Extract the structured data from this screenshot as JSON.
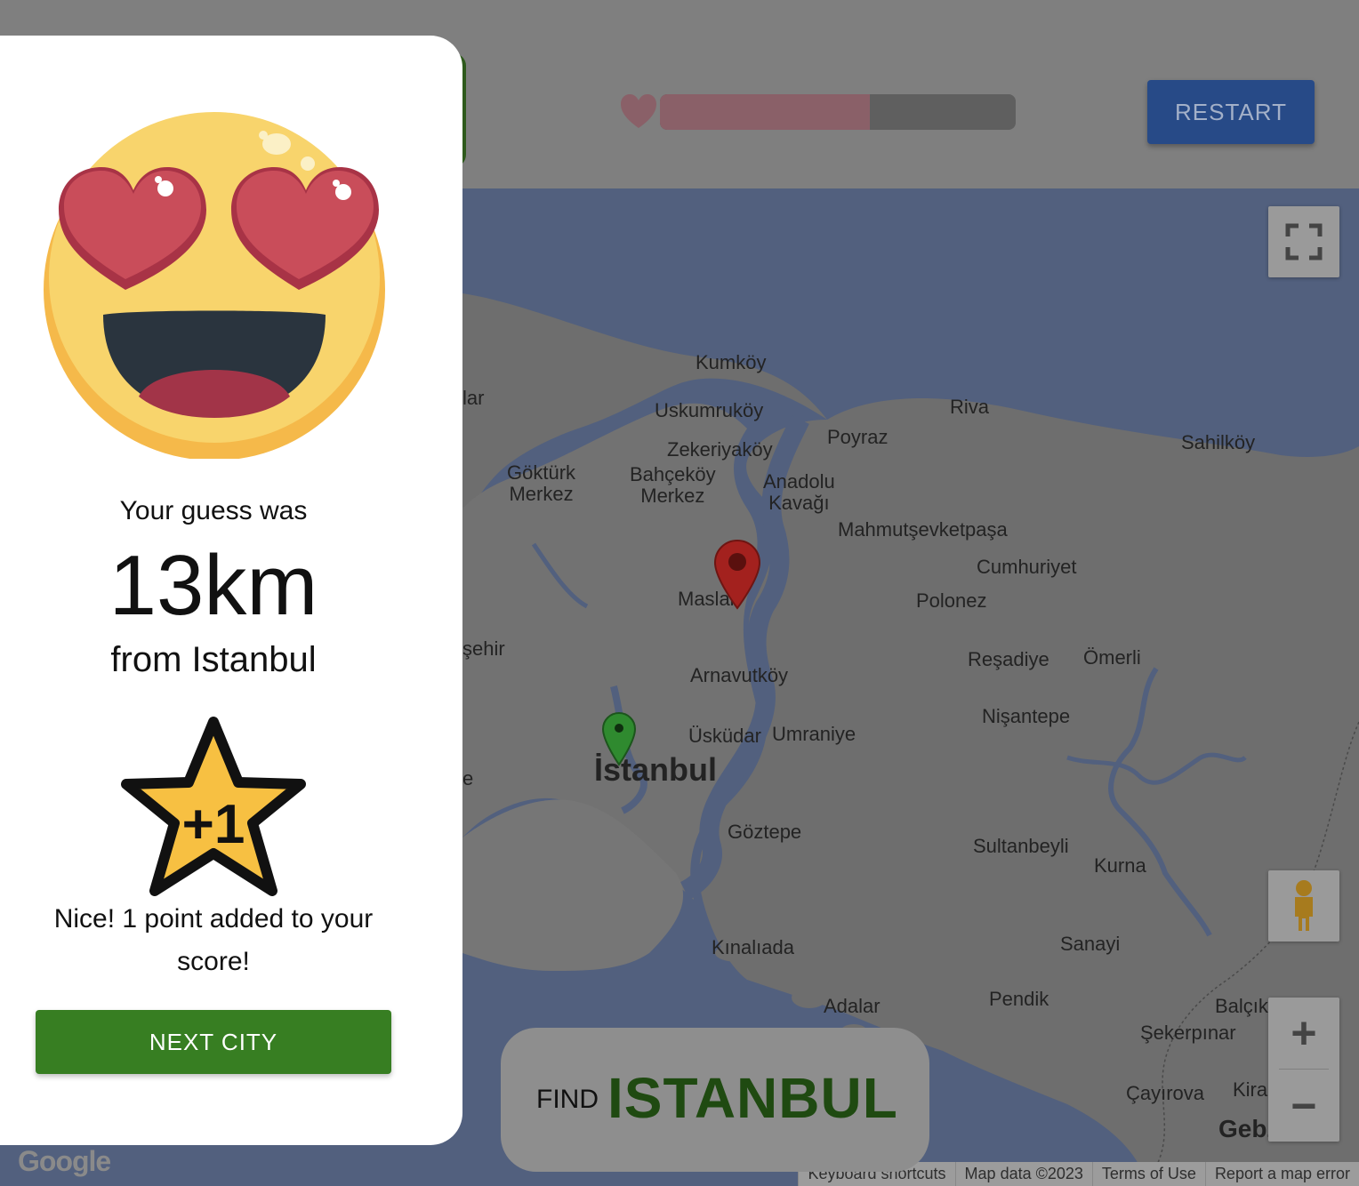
{
  "header": {
    "restart_label": "RESTART",
    "lives_fraction": 0.59
  },
  "result": {
    "guess_label": "Your guess was",
    "distance": "13km",
    "from_city": "from Istanbul",
    "star_badge": "+1",
    "points_message": "Nice! 1 point added to your score!",
    "next_label": "NEXT CITY"
  },
  "find": {
    "prefix": "FIND",
    "city": "ISTANBUL"
  },
  "map": {
    "places": {
      "kumkoy": "Kumköy",
      "uskumrukoy": "Uskumruköy",
      "zekeriyakoy": "Zekeriyaköy",
      "poyraz": "Poyraz",
      "riva": "Riva",
      "sahilkoy": "Sahilköy",
      "gokturk": "Göktürk\nMerkez",
      "bahcekoy": "Bahçeköy\nMerkez",
      "anadolu": "Anadolu\nKavağı",
      "mahmut": "Mahmutşevketpaşa",
      "cumhuriyet": "Cumhuriyet",
      "maslak": "Maslak",
      "polonez": "Polonez",
      "arnavutkoy": "Arnavutköy",
      "resadiye": "Reşadiye",
      "omerli": "Ömerli",
      "nisantepe": "Nişantepe",
      "uskudar": "Üsküdar",
      "umraniye": "Umraniye",
      "istanbul": "İstanbul",
      "goztepe": "Göztepe",
      "sultanbeyli": "Sultanbeyli",
      "kurna": "Kurna",
      "kinaliada": "Kınalıada",
      "sanayi": "Sanayi",
      "adalar": "Adalar",
      "pendik": "Pendik",
      "balcik": "Balçık",
      "sekerpinar": "Şekerpınar",
      "cayirova": "Çayırova",
      "kira": "Kira",
      "gebze": "Gebz",
      "lar": "lar",
      "sehir": "şehir",
      "e_frag": "e"
    },
    "zoom_in": "+",
    "zoom_out": "−",
    "google_logo": "Google",
    "attr_shortcuts": "Keyboard shortcuts",
    "attr_data": "Map data ©2023",
    "attr_terms": "Terms of Use",
    "attr_report": "Report a map error"
  },
  "icons": {
    "heart": "heart-icon",
    "fullscreen": "fullscreen-icon",
    "pegman": "pegman-icon",
    "guess_marker": "red-marker-icon",
    "target_marker": "green-marker-icon",
    "emoji": "heart-eyes-emoji-icon",
    "star": "star-plus-one-icon"
  },
  "colors": {
    "next_button": "#377e22",
    "restart_button": "#274a87",
    "find_city": "#1f4a11",
    "guess_marker": "#a3211e",
    "target_marker": "#2f8a2f"
  }
}
